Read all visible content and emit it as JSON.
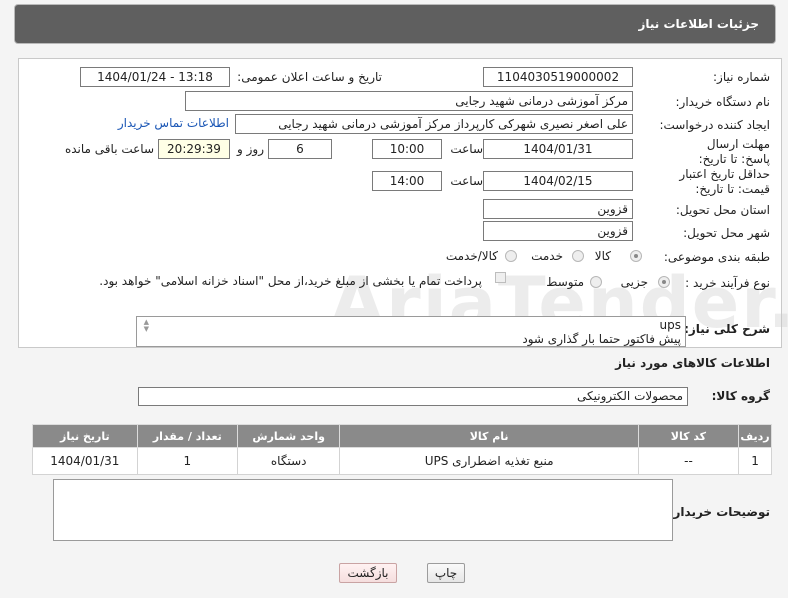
{
  "header": {
    "title": "جزئیات اطلاعات نیاز"
  },
  "form": {
    "need_number": {
      "label": "شماره نیاز:",
      "value": "1104030519000002"
    },
    "announce_datetime": {
      "label": "تاریخ و ساعت اعلان عمومی:",
      "value": "1404/01/24 - 13:18"
    },
    "buyer_org": {
      "label": "نام دستگاه خریدار:",
      "value": "مرکز آموزشی درمانی شهید رجایی"
    },
    "requester": {
      "label": "ایجاد کننده درخواست:",
      "value": "علی اصغر نصیری شهرکی کارپرداز مرکز آموزشی درمانی شهید رجایی",
      "contact_link": "اطلاعات تماس خریدار"
    },
    "deadline": {
      "label": "مهلت ارسال پاسخ: تا تاریخ:",
      "date": "1404/01/31",
      "time_label": "ساعت",
      "time": "10:00",
      "days": "6",
      "days_label": "روز و",
      "remaining": "20:29:39",
      "remaining_label": "ساعت باقی مانده"
    },
    "price_validity": {
      "label": "حداقل تاریخ اعتبار قیمت: تا تاریخ:",
      "date": "1404/02/15",
      "time_label": "ساعت",
      "time": "14:00"
    },
    "delivery_province": {
      "label": "استان محل تحویل:",
      "value": "قزوین"
    },
    "delivery_city": {
      "label": "شهر محل تحویل:",
      "value": "قزوین"
    },
    "category": {
      "label": "طبقه بندی موضوعی:",
      "options": [
        "کالا",
        "خدمت",
        "کالا/خدمت"
      ],
      "selected": "کالا"
    },
    "process_type": {
      "label": "نوع فرآیند خرید :",
      "options": [
        "جزیی",
        "متوسط"
      ],
      "selected": "جزیی",
      "payment_note": "پرداخت تمام یا بخشی از مبلغ خرید،از محل \"اسناد خزانه اسلامی\" خواهد بود."
    },
    "description": {
      "label": "شرح کلی نیاز:",
      "line1": "ups",
      "line2": "پیش فاکتور حتما بار گذاری شود"
    }
  },
  "goods": {
    "section_title": "اطلاعات کالاهای مورد نیاز",
    "group_label": "گروه کالا:",
    "group_value": "محصولات الکترونیکی",
    "columns": [
      "ردیف",
      "کد کالا",
      "نام کالا",
      "واحد شمارش",
      "تعداد / مقدار",
      "تاریخ نیاز"
    ],
    "rows": [
      {
        "row": "1",
        "code": "--",
        "name": "منبع تغذیه اضطراری UPS",
        "unit": "دستگاه",
        "qty": "1",
        "date": "1404/01/31"
      }
    ]
  },
  "buyer_notes": {
    "label": "توضیحات خریدار:"
  },
  "buttons": {
    "print": "چاپ",
    "back": "بازگشت"
  },
  "watermark": "AriaTender.neT"
}
